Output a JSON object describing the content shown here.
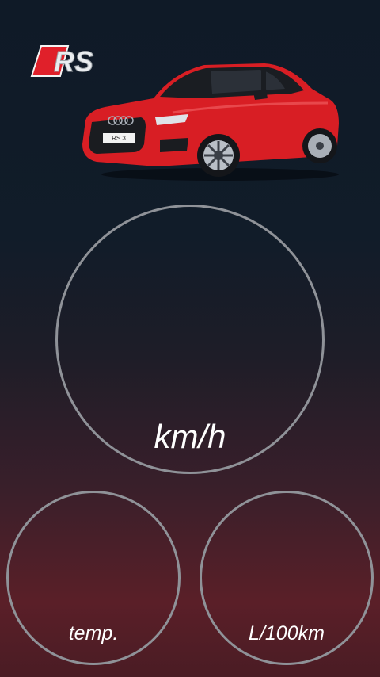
{
  "brand": {
    "logo_text": "RS",
    "accent_color": "#e0202a"
  },
  "car": {
    "plate_text": "RS 3",
    "body_color": "#d81e24"
  },
  "gauges": {
    "speed": {
      "unit": "km/h",
      "value": ""
    },
    "temperature": {
      "unit": "temp.",
      "value": ""
    },
    "consumption": {
      "unit": "L/100km",
      "value": ""
    }
  }
}
